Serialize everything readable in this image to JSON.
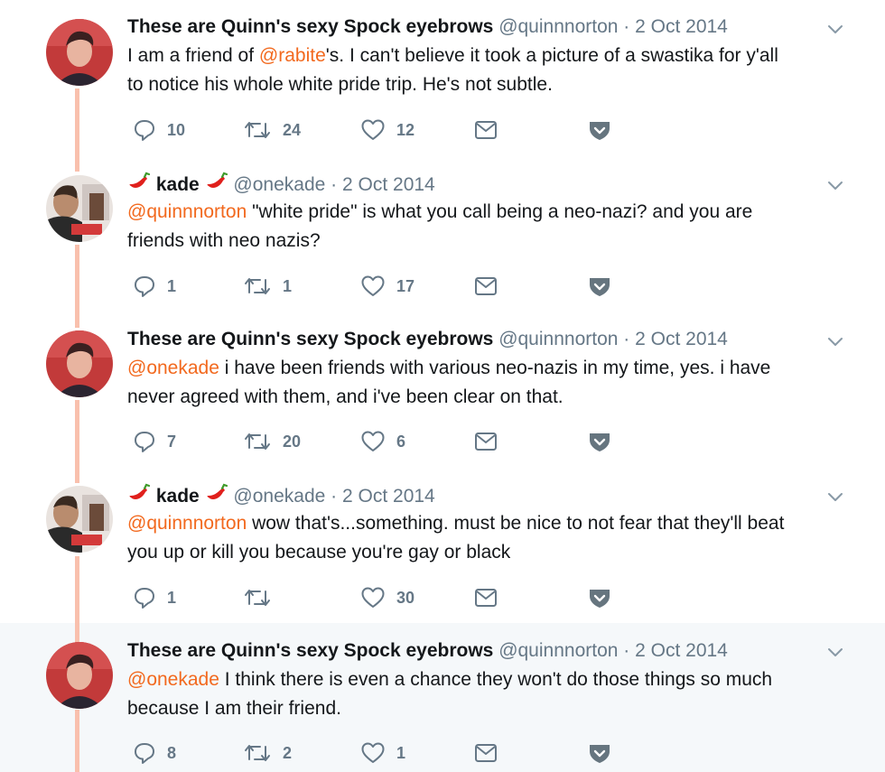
{
  "colors": {
    "accent": "#f2691e",
    "thread_line": "#f9c0ad",
    "muted": "#657786",
    "shield": "#66757f",
    "highlight_bg": "#f5f8fa"
  },
  "icons": {
    "reply": "reply-icon",
    "retweet": "retweet-icon",
    "like": "heart-icon",
    "dm": "envelope-icon",
    "shield": "shield-icon",
    "caret": "chevron-down-icon",
    "emoji": "hot-pepper-emoji"
  },
  "tweets": [
    {
      "name": "These are Quinn's sexy Spock eyebrows",
      "handle": "@quinnnorton",
      "sep": "·",
      "date": "2 Oct 2014",
      "mention": "@rabite",
      "text_l1_after": "'s. I can't believe it took a picture of a swastika for y'all",
      "text_l1_before": "I am a friend of ",
      "text_l2": "to notice his whole white pride trip. He's not subtle.",
      "replies": "10",
      "retweets": "24",
      "likes": "12"
    },
    {
      "name": "kade",
      "handle": "@onekade",
      "sep": "·",
      "date": "2 Oct 2014",
      "mention": "@quinnnorton",
      "text_l1_after": " \"white pride\" is what you call being a neo-nazi? and you are",
      "text_l2": "friends with neo nazis?",
      "replies": "1",
      "retweets": "1",
      "likes": "17"
    },
    {
      "name": "These are Quinn's sexy Spock eyebrows",
      "handle": "@quinnnorton",
      "sep": "·",
      "date": "2 Oct 2014",
      "mention": "@onekade",
      "text_l1_after": " i have been friends with various neo-nazis in my time, yes. i have",
      "text_l2": "never agreed with them, and i've been clear on that.",
      "replies": "7",
      "retweets": "20",
      "likes": "6"
    },
    {
      "name": "kade",
      "handle": "@onekade",
      "sep": "·",
      "date": "2 Oct 2014",
      "mention": "@quinnnorton",
      "text_l1_after": " wow that's...something. must be nice to not fear that they'll beat",
      "text_l2": "you up or kill you because you're gay or black",
      "replies": "1",
      "retweets": "",
      "likes": "30"
    },
    {
      "name": "These are Quinn's sexy Spock eyebrows",
      "handle": "@quinnnorton",
      "sep": "·",
      "date": "2 Oct 2014",
      "mention": "@onekade",
      "text_l1_after": " I think there is even a chance they won't do those things so much",
      "text_l2": "because I am their friend.",
      "replies": "8",
      "retweets": "2",
      "likes": "1"
    }
  ]
}
